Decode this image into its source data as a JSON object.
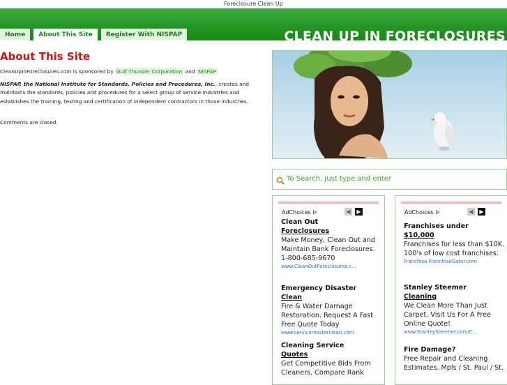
{
  "topbar": {
    "text": "Foreclosure Clean Up"
  },
  "header": {
    "site_title": "CLEAN UP IN FORECLOSURES"
  },
  "tabs": [
    {
      "label": "Home"
    },
    {
      "label": "About This Site"
    },
    {
      "label": "Register With NISPAP"
    }
  ],
  "main": {
    "title": "About This Site",
    "p1_prefix": "CleanUpInForeclosures.com is sponsored by",
    "p1_link1": "Gulf Thunder Corporation",
    "p1_mid": "and",
    "p1_link2": "NISPAP",
    "p2_bold": "NISPAP, the National Institute for Standards, Policies and Procedures, Inc.",
    "p2_rest": ", creates and maintains the standards, policies and procedures for a select group of service industries and establishes the training, testing and certification of independent contractors in those industries.",
    "p3": "Comments are closed."
  },
  "search": {
    "placeholder": "To Search, just type and enter"
  },
  "ad_columns": [
    {
      "adchoices": "AdChoices",
      "ads": [
        {
          "title_a": "Clean Out",
          "title_b": "Foreclosures",
          "body": "Make Money, Clean Out and Maintain Bank Foreclosures. 1-800-685-9670",
          "url": "www.CleanOutForeclosures.c..."
        },
        {
          "title_a": "Emergency Disaster",
          "title_b": "Clean",
          "body": "Fire & Water Damage Restoration. Request A Fast Free Quote Today",
          "url": "www.servicemasterclean.com"
        },
        {
          "title_a": "Cleaning Service",
          "title_b": "Quotes",
          "body": "Get Competitive Bids From Cleaners. Compare Rank",
          "url": ""
        }
      ]
    },
    {
      "adchoices": "AdChoices",
      "ads": [
        {
          "title_a": "Franchises under",
          "title_b": "$10,000",
          "body": "Franchises for less than $10K. 100's of low cost franchises.",
          "url": "Franchise.FranchiseGator.com"
        },
        {
          "title_a": "Stanley Steemer",
          "title_b": "Cleaning",
          "body": "We Clean More Than Just Carpet. Visit Us For A Free Online Quote!",
          "url": "www.StanleySteemer.com/C..."
        },
        {
          "title_a": "Fire Damage?",
          "title_b": "",
          "body": "Free Repair and Cleaning Estimates. Mpls / St. Paul / St.",
          "url": ""
        }
      ]
    }
  ],
  "colors": {
    "header_green": "#2a9a2a",
    "accent_green": "#1a8a1a",
    "title_red": "#d11414",
    "link_blue": "#2b6fd1"
  }
}
